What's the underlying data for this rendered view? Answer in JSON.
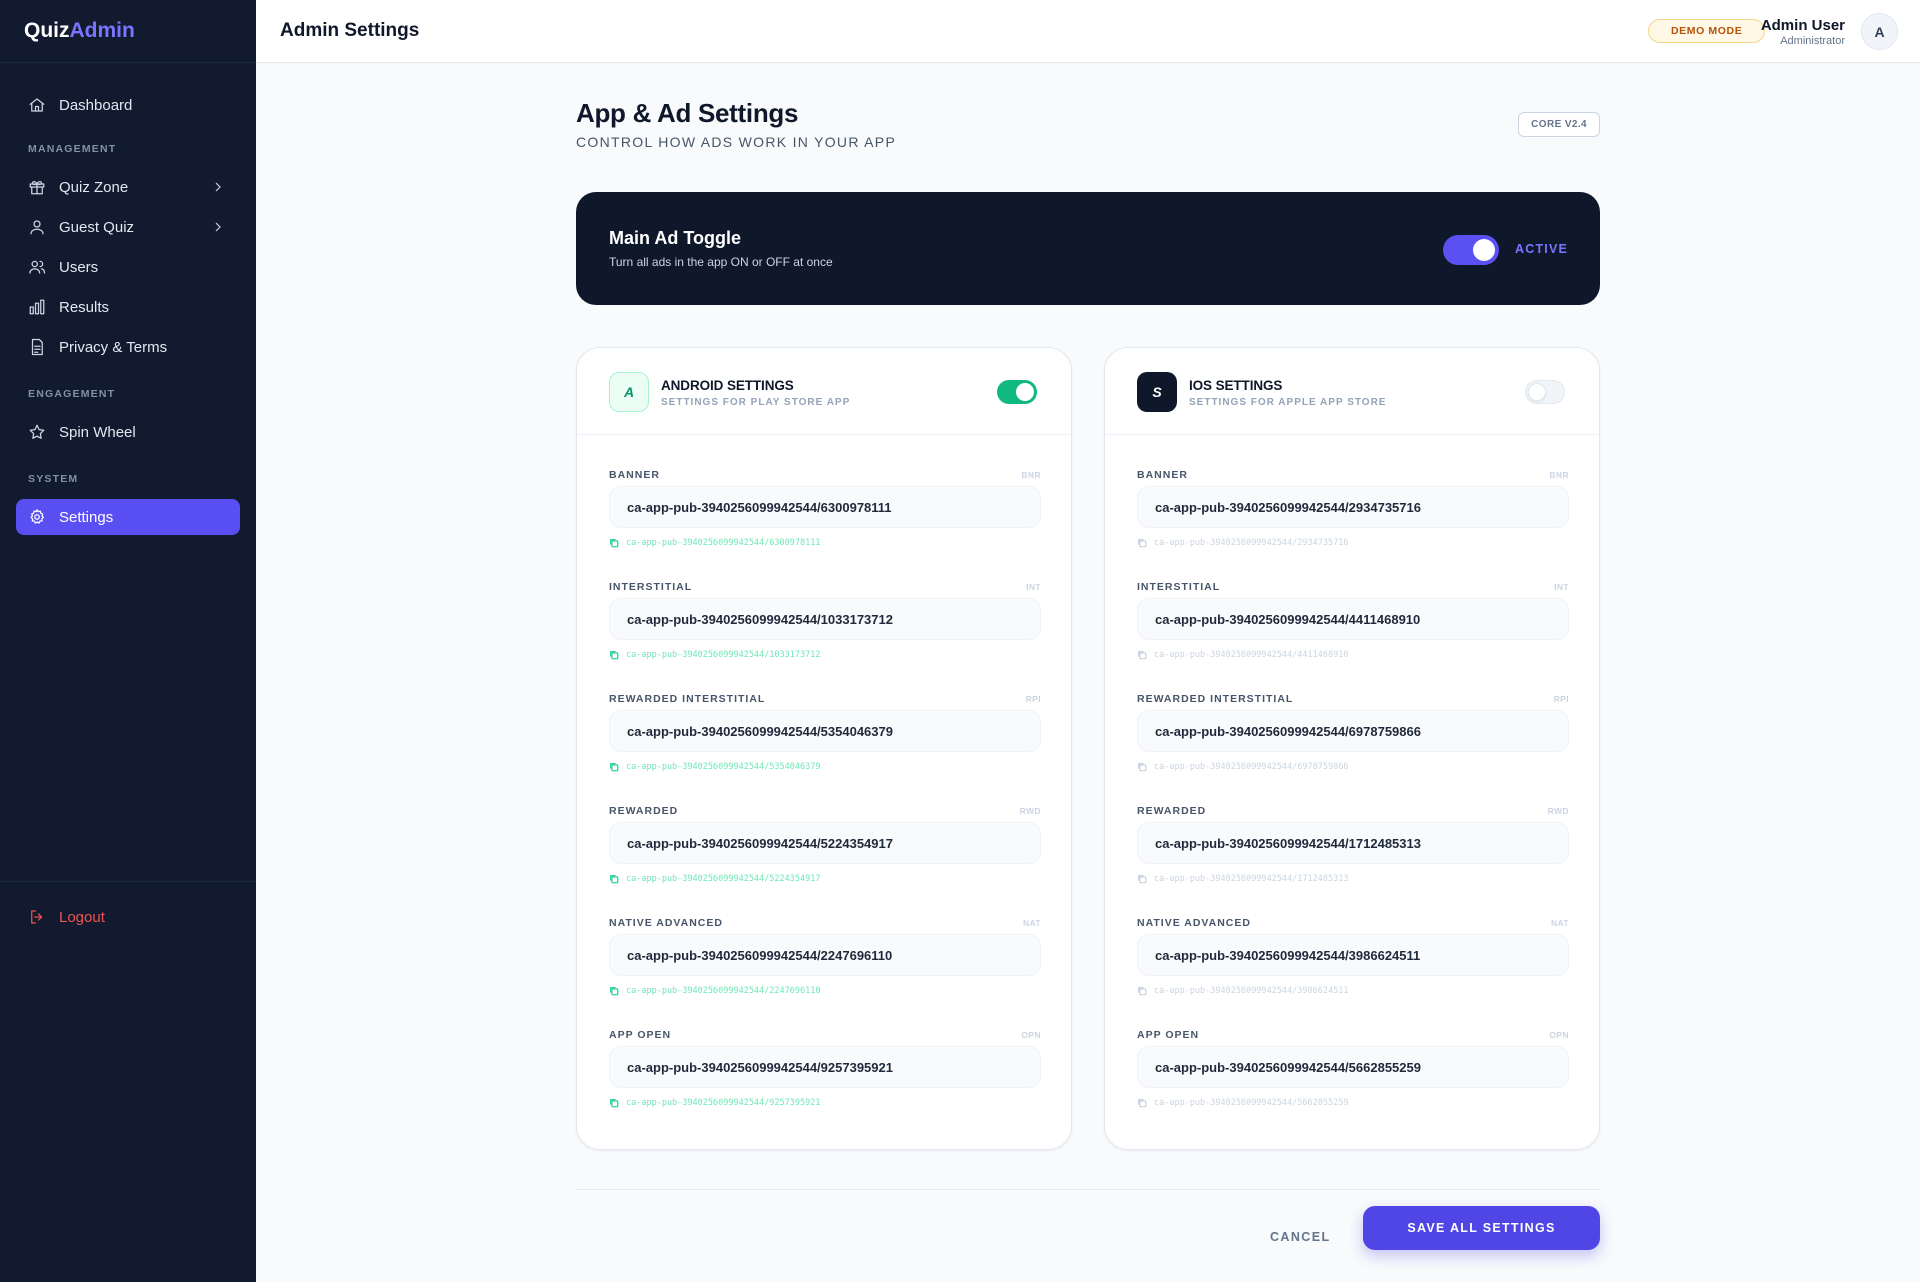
{
  "brand": {
    "part1": "Quiz",
    "part2": "Admin"
  },
  "sidebar": {
    "items": [
      {
        "label": "Dashboard",
        "icon": "home-icon"
      },
      {
        "section": "MANAGEMENT"
      },
      {
        "label": "Quiz Zone",
        "icon": "gift-icon",
        "expandable": true
      },
      {
        "label": "Guest Quiz",
        "icon": "user-icon",
        "expandable": true
      },
      {
        "label": "Users",
        "icon": "users-icon"
      },
      {
        "label": "Results",
        "icon": "bar-chart-icon"
      },
      {
        "label": "Privacy & Terms",
        "icon": "document-icon"
      },
      {
        "section": "ENGAGEMENT"
      },
      {
        "label": "Spin Wheel",
        "icon": "star-icon"
      },
      {
        "section": "SYSTEM"
      },
      {
        "label": "Settings",
        "icon": "gear-icon",
        "active": true
      }
    ],
    "logout": "Logout"
  },
  "header": {
    "title": "Admin Settings",
    "badge": "DEMO MODE",
    "user_name": "Admin User",
    "user_role": "Administrator",
    "avatar": "A"
  },
  "page": {
    "title": "App & Ad Settings",
    "subtitle": "CONTROL HOW ADS WORK IN YOUR APP",
    "version": "CORE V2.4"
  },
  "main_toggle": {
    "title": "Main Ad Toggle",
    "description": "Turn all ads in the app ON or OFF at once",
    "state": "ACTIVE",
    "on": true
  },
  "android": {
    "icon": "A",
    "title": "ANDROID SETTINGS",
    "subtitle": "SETTINGS FOR PLAY STORE APP",
    "enabled": true,
    "fields": [
      {
        "label": "BANNER",
        "code": "BNR",
        "value": "ca-app-pub-3940256099942544/6300978111"
      },
      {
        "label": "INTERSTITIAL",
        "code": "INT",
        "value": "ca-app-pub-3940256099942544/1033173712"
      },
      {
        "label": "REWARDED INTERSTITIAL",
        "code": "RPI",
        "value": "ca-app-pub-3940256099942544/5354046379"
      },
      {
        "label": "REWARDED",
        "code": "RWD",
        "value": "ca-app-pub-3940256099942544/5224354917"
      },
      {
        "label": "NATIVE ADVANCED",
        "code": "NAT",
        "value": "ca-app-pub-3940256099942544/2247696110"
      },
      {
        "label": "APP OPEN",
        "code": "OPN",
        "value": "ca-app-pub-3940256099942544/9257395921"
      }
    ]
  },
  "ios": {
    "icon": "S",
    "title": "IOS SETTINGS",
    "subtitle": "SETTINGS FOR APPLE APP STORE",
    "enabled": false,
    "fields": [
      {
        "label": "BANNER",
        "code": "BNR",
        "value": "ca-app-pub-3940256099942544/2934735716"
      },
      {
        "label": "INTERSTITIAL",
        "code": "INT",
        "value": "ca-app-pub-3940256099942544/4411468910"
      },
      {
        "label": "REWARDED INTERSTITIAL",
        "code": "RPI",
        "value": "ca-app-pub-3940256099942544/6978759866"
      },
      {
        "label": "REWARDED",
        "code": "RWD",
        "value": "ca-app-pub-3940256099942544/1712485313"
      },
      {
        "label": "NATIVE ADVANCED",
        "code": "NAT",
        "value": "ca-app-pub-3940256099942544/3986624511"
      },
      {
        "label": "APP OPEN",
        "code": "OPN",
        "value": "ca-app-pub-3940256099942544/5662855259"
      }
    ]
  },
  "actions": {
    "cancel": "CANCEL",
    "save": "SAVE ALL SETTINGS"
  },
  "colors": {
    "accent": "#5a4ff3",
    "sidebar_bg": "#111a2e",
    "android": "#10b981",
    "danger": "#f05252"
  }
}
